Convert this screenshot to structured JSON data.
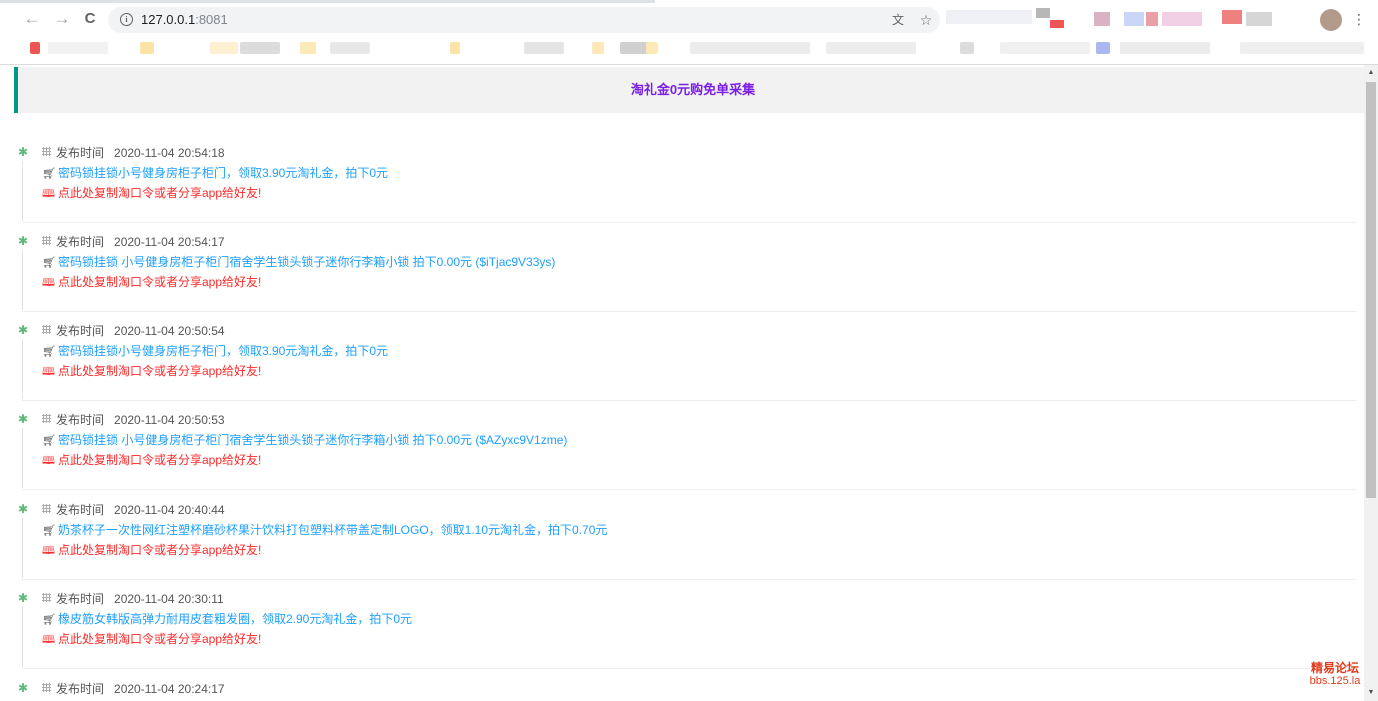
{
  "browser": {
    "url_host": "127.0.0.1",
    "url_port": ":8081",
    "back_icon": "←",
    "forward_icon": "→",
    "reload_icon": "C",
    "translate_icon": "文",
    "star_icon": "☆",
    "menu_icon": "⋮"
  },
  "header": {
    "title": "淘礼金0元购免单采集",
    "accent": "#009688",
    "title_color": "#7b1fe6"
  },
  "items": [
    {
      "label": "发布时间",
      "time": "2020-11-04 20:54:18",
      "title": "密码锁挂锁小号健身房柜子柜门，领取3.90元淘礼金，拍下0元",
      "share": "点此处复制淘口令或者分享app给好友!"
    },
    {
      "label": "发布时间",
      "time": "2020-11-04 20:54:17",
      "title": "密码锁挂锁 小号健身房柜子柜门宿舍学生锁头锁子迷你行李箱小锁 拍下0.00元 ($iTjac9V33ys)",
      "share": "点此处复制淘口令或者分享app给好友!"
    },
    {
      "label": "发布时间",
      "time": "2020-11-04 20:50:54",
      "title": "密码锁挂锁小号健身房柜子柜门，领取3.90元淘礼金，拍下0元",
      "share": "点此处复制淘口令或者分享app给好友!"
    },
    {
      "label": "发布时间",
      "time": "2020-11-04 20:50:53",
      "title": "密码锁挂锁 小号健身房柜子柜门宿舍学生锁头锁子迷你行李箱小锁 拍下0.00元 ($AZyxc9V1zme)",
      "share": "点此处复制淘口令或者分享app给好友!"
    },
    {
      "label": "发布时间",
      "time": "2020-11-04 20:40:44",
      "title": "奶茶杯子一次性网红注塑杯磨砂杯果汁饮料打包塑料杯带盖定制LOGO，领取1.10元淘礼金，拍下0.70元",
      "share": "点此处复制淘口令或者分享app给好友!"
    },
    {
      "label": "发布时间",
      "time": "2020-11-04 20:30:11",
      "title": "橡皮筋女韩版高弹力耐用皮套粗发圈，领取2.90元淘礼金，拍下0元",
      "share": "点此处复制淘口令或者分享app给好友!"
    },
    {
      "label": "发布时间",
      "time": "2020-11-04 20:24:17",
      "title": "",
      "share": ""
    }
  ],
  "icons": {
    "timeline_icon": "palm-tree-icon",
    "time_icon": "grid-icon",
    "cart_icon": "cart-icon",
    "share_icon": "book-icon"
  },
  "watermark": {
    "line1": "精易论坛",
    "line2": "bbs.125.la"
  }
}
